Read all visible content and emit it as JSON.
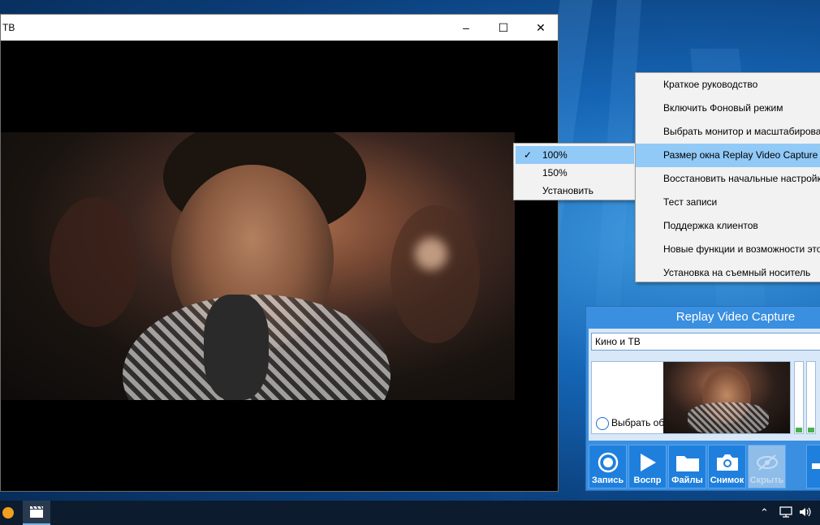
{
  "player": {
    "title": "ТВ",
    "controls": {
      "minimize": "–",
      "maximize": "☐",
      "close": "✕"
    }
  },
  "context_menu": {
    "items": [
      {
        "label": "Краткое руководство",
        "highlighted": false
      },
      {
        "label": "Включить Фоновый режим",
        "highlighted": false
      },
      {
        "label": "Выбрать монитор и масштабирова",
        "highlighted": false
      },
      {
        "label": "Размер окна Replay Video Capture",
        "highlighted": true
      },
      {
        "label": "Восстановить начальные настройк",
        "highlighted": false
      },
      {
        "label": "Тест записи",
        "highlighted": false
      },
      {
        "label": "Поддержка клиентов",
        "highlighted": false
      },
      {
        "label": "Новые функции и возможности это",
        "highlighted": false
      },
      {
        "label": "Установка на съемный носитель",
        "highlighted": false
      }
    ]
  },
  "submenu": {
    "items": [
      {
        "label": "100%",
        "checked": true,
        "highlighted": true
      },
      {
        "label": "150%",
        "checked": false,
        "highlighted": false
      },
      {
        "label": "Установить",
        "checked": false,
        "highlighted": false
      }
    ],
    "check_glyph": "✓"
  },
  "rvc": {
    "title": "Replay Video Capture",
    "source": "Кино и ТВ",
    "select_area_label": "Выбрать об",
    "buttons": [
      {
        "label": "Запись",
        "icon": "record-icon",
        "disabled": false
      },
      {
        "label": "Воспр",
        "icon": "play-icon",
        "disabled": false
      },
      {
        "label": "Файлы",
        "icon": "folder-icon",
        "disabled": false
      },
      {
        "label": "Снимок",
        "icon": "camera-icon",
        "disabled": false
      },
      {
        "label": "Скрыть",
        "icon": "hide-eye-icon",
        "disabled": true
      }
    ]
  },
  "taskbar": {
    "tray_icons": [
      "chevron-up-icon",
      "network-icon",
      "volume-icon"
    ],
    "apps": [
      "orange-app-icon",
      "video-app-icon"
    ]
  },
  "colors": {
    "menu_highlight": "#91c9f7",
    "rvc_blue": "#3a8fe0",
    "button_blue": "#1f7fdc"
  }
}
